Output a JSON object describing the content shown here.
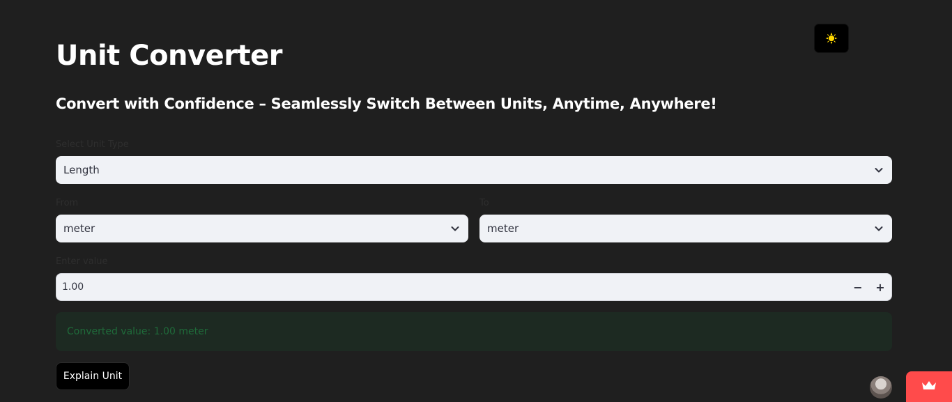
{
  "header": {
    "title": "Unit Converter",
    "subtitle": "Convert with Confidence – Seamlessly Switch Between Units, Anytime, Anywhere!",
    "theme_toggle_icon": "sun-icon"
  },
  "form": {
    "unit_type": {
      "label": "Select Unit Type",
      "value": "Length"
    },
    "from": {
      "label": "From",
      "value": "meter"
    },
    "to": {
      "label": "To",
      "value": "meter"
    },
    "value_input": {
      "label": "Enter value",
      "value": "1.00",
      "decrement": "−",
      "increment": "+"
    }
  },
  "result": {
    "text": "Converted value: 1.00 meter"
  },
  "actions": {
    "explain_label": "Explain Unit"
  },
  "footer": {
    "avatar_icon": "user-avatar",
    "badge_icon": "crown-icon"
  },
  "colors": {
    "background": "#1f1f1f",
    "input_bg": "#f0f2f6",
    "success_bg": "#1d2a22",
    "success_text": "#1f6b3a",
    "accent": "#ff4b4b",
    "sun": "#ffd700"
  }
}
